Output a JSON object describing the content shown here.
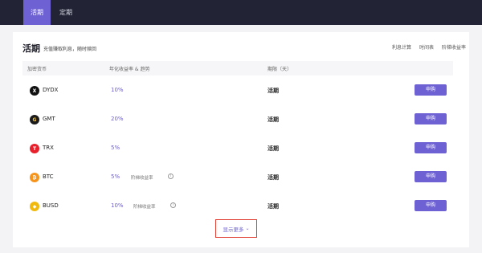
{
  "tabs": [
    {
      "label": "活期",
      "active": true
    },
    {
      "label": "定期",
      "active": false
    }
  ],
  "header": {
    "title": "活期",
    "subtitle": "充值赚取利息，随时赎回",
    "links": [
      "利息计算",
      "时间表",
      "阶梯收益率"
    ]
  },
  "table": {
    "columns": [
      "加密货币",
      "年化收益率 & 趋势",
      "期限（天）"
    ],
    "rows": [
      {
        "coin": "DYDX",
        "rate": "10%",
        "tier": "",
        "term": "活期",
        "button": "申购",
        "icon_color": "#111111",
        "icon": "dydx-icon",
        "glyph": "X"
      },
      {
        "coin": "GMT",
        "rate": "20%",
        "tier": "",
        "term": "活期",
        "button": "申购",
        "icon_color": "#1b1b1b",
        "icon": "gmt-icon",
        "glyph": "G"
      },
      {
        "coin": "TRX",
        "rate": "5%",
        "tier": "",
        "term": "活期",
        "button": "申购",
        "icon_color": "#e8202b",
        "icon": "trx-icon",
        "glyph": "T"
      },
      {
        "coin": "BTC",
        "rate": "5%",
        "tier": "阶梯收益率",
        "term": "活期",
        "button": "申购",
        "icon_color": "#f6931a",
        "icon": "btc-icon",
        "glyph": "₿"
      },
      {
        "coin": "BUSD",
        "rate": "10%",
        "tier": "阶梯收益率",
        "term": "活期",
        "button": "申购",
        "icon_color": "#f0b90b",
        "icon": "busd-icon",
        "glyph": "◆"
      }
    ]
  },
  "show_more": {
    "label": "显示更多"
  },
  "colors": {
    "accent": "#6e61d4",
    "topbar": "#222436",
    "highlight": "#e03a2e"
  }
}
